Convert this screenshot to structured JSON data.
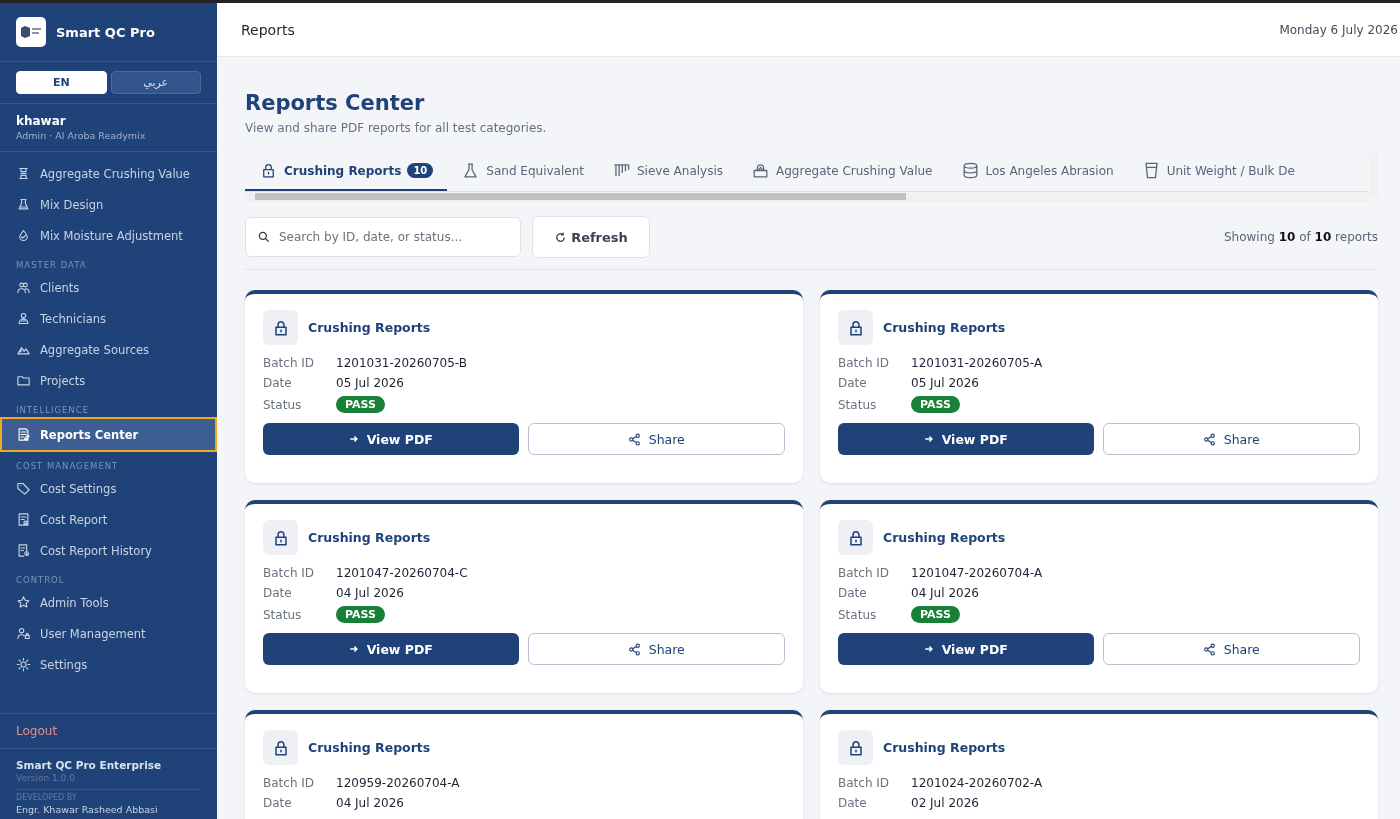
{
  "sidebar": {
    "brand": "Smart QC Pro",
    "languages": [
      {
        "label": "EN",
        "selected": true
      },
      {
        "label": "عربي",
        "selected": false
      }
    ],
    "user": {
      "name": "khawar",
      "role": "Admin · Al Aroba Readymix"
    },
    "sections": [
      {
        "items": [
          {
            "label": "Aggregate Crushing Value",
            "selected": false
          },
          {
            "label": "Mix Design",
            "selected": false
          },
          {
            "label": "Mix Moisture Adjustment",
            "selected": false
          }
        ]
      },
      {
        "heading": "MASTER DATA",
        "items": [
          {
            "label": "Clients",
            "selected": false
          },
          {
            "label": "Technicians",
            "selected": false
          },
          {
            "label": "Aggregate Sources",
            "selected": false
          },
          {
            "label": "Projects",
            "selected": false
          }
        ]
      },
      {
        "heading": "INTELLIGENCE",
        "items": [
          {
            "label": "Reports Center",
            "selected": true
          }
        ]
      },
      {
        "heading": "COST MANAGEMENT",
        "items": [
          {
            "label": "Cost Settings",
            "selected": false
          },
          {
            "label": "Cost Report",
            "selected": false
          },
          {
            "label": "Cost Report History",
            "selected": false
          }
        ]
      },
      {
        "heading": "CONTROL",
        "items": [
          {
            "label": "Admin Tools",
            "selected": false
          },
          {
            "label": "User Management",
            "selected": false
          },
          {
            "label": "Settings",
            "selected": false
          }
        ]
      }
    ],
    "logout": "Logout",
    "footer": {
      "product": "Smart QC Pro Enterprise",
      "version": "Version 1.0.0",
      "developed_by": "DEVELOPED BY",
      "developer": "Engr. Khawar Rasheed Abbasi"
    }
  },
  "header": {
    "title": "Reports",
    "date": "Monday 6 July 2026"
  },
  "page": {
    "title": "Reports Center",
    "subtitle": "View and share PDF reports for all test categories."
  },
  "tabs": [
    {
      "label": "Crushing Reports",
      "count": "10",
      "selected": true
    },
    {
      "label": "Sand Equivalent",
      "selected": false
    },
    {
      "label": "Sieve Analysis",
      "selected": false
    },
    {
      "label": "Aggregate Crushing Value",
      "selected": false
    },
    {
      "label": "Los Angeles Abrasion",
      "selected": false
    },
    {
      "label": "Unit Weight / Bulk De",
      "selected": false
    }
  ],
  "toolbar": {
    "search_placeholder": "Search by ID, date, or status...",
    "refresh": "Refresh",
    "showing": "Showing **10** of **10** reports"
  },
  "cards": [
    {
      "title": "Crushing Reports",
      "batch_label": "Batch ID",
      "batch_id": "1201031-20260705-B",
      "date_label": "Date",
      "date": "05 Jul 2026",
      "status_label": "Status",
      "status": "PASS",
      "view": "View PDF",
      "share": "Share"
    },
    {
      "title": "Crushing Reports",
      "batch_label": "Batch ID",
      "batch_id": "1201031-20260705-A",
      "date_label": "Date",
      "date": "05 Jul 2026",
      "status_label": "Status",
      "status": "PASS",
      "view": "View PDF",
      "share": "Share"
    },
    {
      "title": "Crushing Reports",
      "batch_label": "Batch ID",
      "batch_id": "1201047-20260704-C",
      "date_label": "Date",
      "date": "04 Jul 2026",
      "status_label": "Status",
      "status": "PASS",
      "view": "View PDF",
      "share": "Share"
    },
    {
      "title": "Crushing Reports",
      "batch_label": "Batch ID",
      "batch_id": "1201047-20260704-A",
      "date_label": "Date",
      "date": "04 Jul 2026",
      "status_label": "Status",
      "status": "PASS",
      "view": "View PDF",
      "share": "Share"
    },
    {
      "title": "Crushing Reports",
      "batch_label": "Batch ID",
      "batch_id": "120959-20260704-A",
      "date_label": "Date",
      "date": "04 Jul 2026"
    },
    {
      "title": "Crushing Reports",
      "batch_label": "Batch ID",
      "batch_id": "1201024-20260702-A",
      "date_label": "Date",
      "date": "02 Jul 2026"
    }
  ]
}
